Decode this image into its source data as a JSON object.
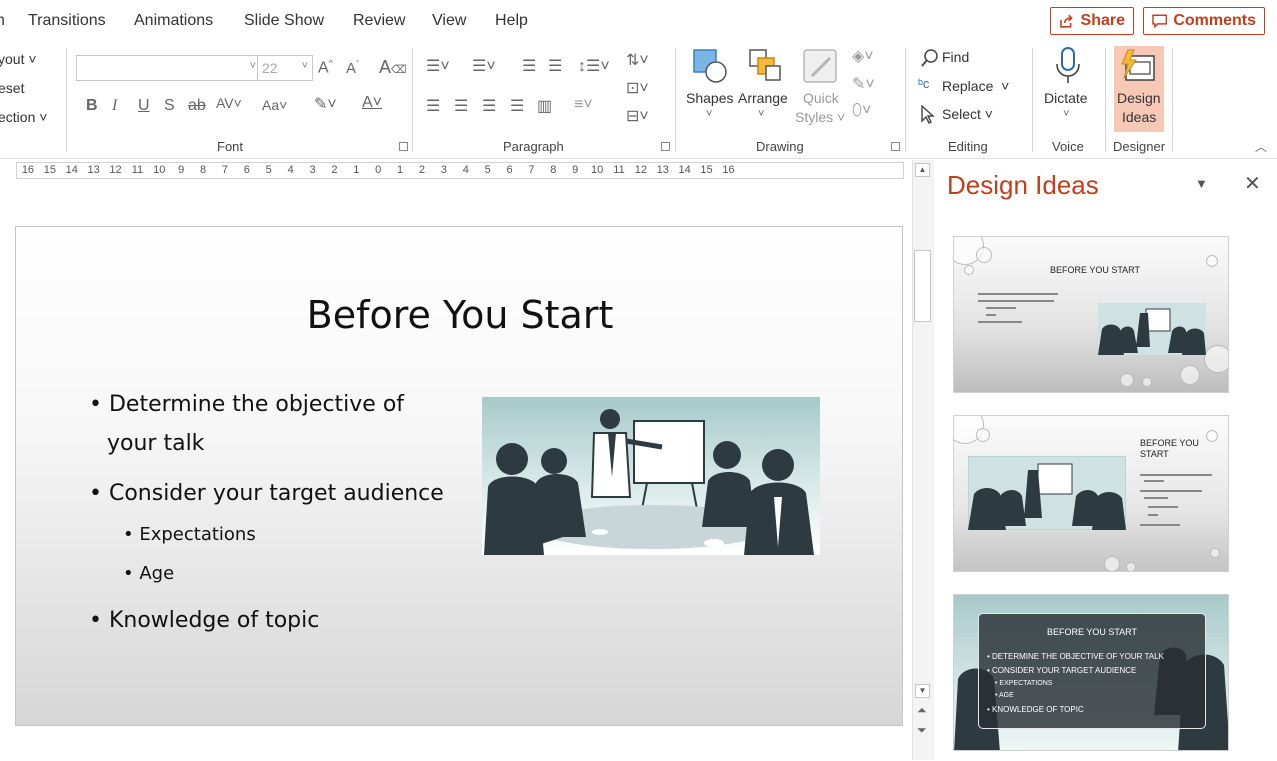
{
  "tabs": [
    "n",
    "Transitions",
    "Animations",
    "Slide Show",
    "Review",
    "View",
    "Help"
  ],
  "share_label": "Share",
  "comments_label": "Comments",
  "ribbon": {
    "slides_partial": [
      "yout",
      "eset",
      "ection"
    ],
    "font": {
      "font_name": "",
      "font_size": "22",
      "group_label": "Font"
    },
    "paragraph": {
      "group_label": "Paragraph"
    },
    "drawing": {
      "shapes": "Shapes",
      "arrange": "Arrange",
      "quick": "Quick",
      "styles": "Styles",
      "group_label": "Drawing"
    },
    "editing": {
      "find": "Find",
      "replace": "Replace",
      "select": "Select",
      "group_label": "Editing"
    },
    "voice": {
      "dictate": "Dictate",
      "group_label": "Voice"
    },
    "designer": {
      "design": "Design",
      "ideas": "Ideas",
      "group_label": "Designer"
    }
  },
  "ruler_marks": [
    "16",
    "15",
    "14",
    "13",
    "12",
    "11",
    "10",
    "9",
    "8",
    "7",
    "6",
    "5",
    "4",
    "3",
    "2",
    "1",
    "0",
    "1",
    "2",
    "3",
    "4",
    "5",
    "6",
    "7",
    "8",
    "9",
    "10",
    "11",
    "12",
    "13",
    "14",
    "15",
    "16"
  ],
  "slide": {
    "title": "Before You Start",
    "bullets": [
      {
        "text": "• Determine the objective of",
        "level": 1
      },
      {
        "text": "your talk",
        "level": 1
      },
      {
        "text": "• Consider your target audience",
        "level": 1
      },
      {
        "text": "• Expectations",
        "level": 2
      },
      {
        "text": "• Age",
        "level": 2
      },
      {
        "text": "• Knowledge of topic",
        "level": 1
      }
    ]
  },
  "design_pane": {
    "title": "Design Ideas",
    "thumb1": {
      "title": "BEFORE YOU START"
    },
    "thumb2": {
      "title_line1": "BEFORE YOU",
      "title_line2": "START"
    },
    "thumb3": {
      "title": "BEFORE YOU START",
      "lines": [
        "• DETERMINE THE OBJECTIVE OF YOUR TALK",
        "• CONSIDER YOUR TARGET AUDIENCE",
        "• EXPECTATIONS",
        "• AGE",
        "• KNOWLEDGE OF TOPIC"
      ]
    }
  },
  "colors": {
    "accent": "#c43e1c",
    "designer_highlight": "#f8c8b6",
    "photo_teal": "#a7c9c9",
    "silhouette": "#2d3b41"
  }
}
